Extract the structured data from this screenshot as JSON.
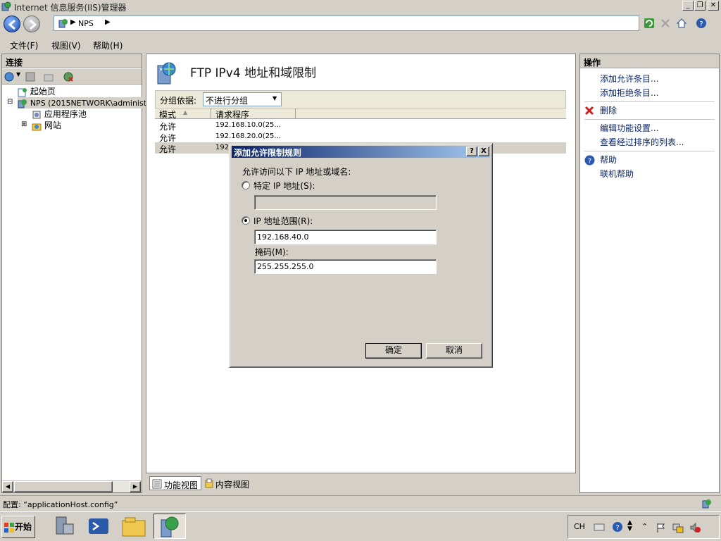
{
  "window": {
    "title": "Internet 信息服务(IIS)管理器"
  },
  "address": {
    "crumb": "NPS"
  },
  "menu": {
    "file": "文件(F)",
    "view": "视图(V)",
    "help": "帮助(H)"
  },
  "connections": {
    "header": "连接",
    "tree": {
      "start": "起始页",
      "server": "NPS (2015NETWORK\\administr",
      "app_pools": "应用程序池",
      "sites": "网站"
    }
  },
  "feature": {
    "title": "FTP IPv4 地址和域限制",
    "group_label": "分组依据:",
    "group_value": "不进行分组",
    "columns": [
      "模式",
      "请求程序"
    ],
    "rows": [
      {
        "mode": "允许",
        "requester": "192.168.10.0(25..."
      },
      {
        "mode": "允许",
        "requester": "192.168.20.0(25..."
      },
      {
        "mode": "允许",
        "requester": "192"
      }
    ],
    "tab_features": "功能视图",
    "tab_content": "内容视图"
  },
  "actions": {
    "header": "操作",
    "add_allow": "添加允许条目...",
    "add_deny": "添加拒绝条目...",
    "delete": "删除",
    "edit_settings": "编辑功能设置...",
    "view_ordered": "查看经过排序的列表...",
    "help": "帮助",
    "online_help": "联机帮助"
  },
  "dialog": {
    "title": "添加允许限制规则",
    "prompt": "允许访问以下 IP 地址或域名:",
    "specific_ip_label": "特定 IP 地址(S):",
    "specific_ip_value": "",
    "range_label": "IP 地址范围(R):",
    "range_value": "192.168.40.0",
    "mask_label": "掩码(M):",
    "mask_value": "255.255.255.0",
    "ok": "确定",
    "cancel": "取消",
    "help_btn": "?",
    "close_btn": "X",
    "selected_option": "range"
  },
  "status": {
    "text": "配置: “applicationHost.config”"
  },
  "taskbar": {
    "start": "开始",
    "lang": "CH"
  }
}
